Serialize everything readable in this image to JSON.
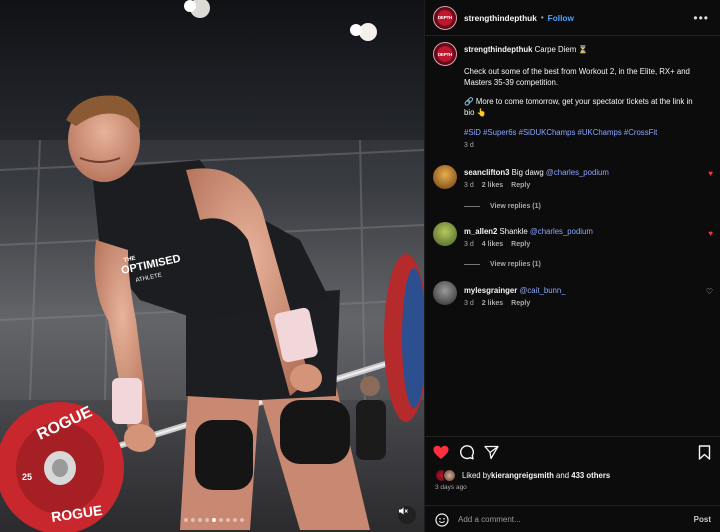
{
  "post": {
    "author": "strengthindepthuk",
    "follow_label": "Follow",
    "separator": "•",
    "more_icon": "more-dots-icon",
    "avatar_text": "DEPTH"
  },
  "caption": {
    "author": "strengthindepthuk",
    "first_line": "Carpe Diem ⏳",
    "body": "Check out some of the best from Workout 2, in the Elite, RX+ and Masters 35-39 competition.",
    "note": "🔗 More to come tomorrow, get your spectator tickets at the link in bio 👆",
    "hashtags": "#SiD #Super6s #SiDUKChamps #UKChamps #CrossFit",
    "time": "3 d"
  },
  "comments": [
    {
      "user": "seanclifton3",
      "text": "Big dawg ",
      "mention": "@charles_podium",
      "time": "3 d",
      "likes": "2 likes",
      "reply": "Reply",
      "view_replies": "View replies (1)",
      "liked": true
    },
    {
      "user": "m_allen2",
      "text": "Shankle ",
      "mention": "@charles_podium",
      "time": "3 d",
      "likes": "4 likes",
      "reply": "Reply",
      "view_replies": "View replies (1)",
      "liked": true
    },
    {
      "user": "mylesgrainger",
      "text": "",
      "mention": "@cait_bunn_",
      "time": "3 d",
      "likes": "2 likes",
      "reply": "Reply",
      "view_replies": "",
      "liked": false
    }
  ],
  "actions": {
    "liked_by_prefix": "Liked by ",
    "liked_by_user": "kierangreigsmith",
    "liked_by_mid": " and ",
    "liked_by_count": "433 others",
    "posted_ago": "3 days ago"
  },
  "composer": {
    "placeholder": "Add a comment...",
    "post_label": "Post"
  },
  "media": {
    "plate_brand": "ROGUE",
    "plate_weight": "25",
    "shirt_text_1": "THE",
    "shirt_text_2": "OPTIMISED",
    "shirt_text_3": "ATHLETE",
    "carousel_count": 9,
    "carousel_active": 4
  },
  "colors": {
    "like_red": "#ff3040",
    "link_blue": "#4aa3ff",
    "mention": "#8aa6ff",
    "plate_red": "#c8272d"
  }
}
